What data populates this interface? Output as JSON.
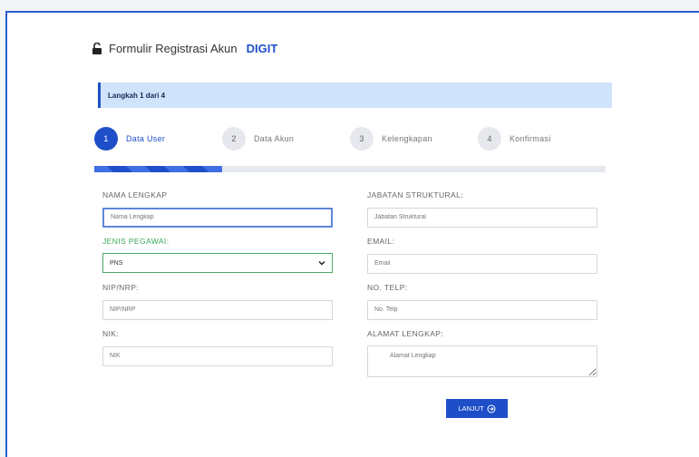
{
  "header": {
    "title_prefix": "Formulir Registrasi Akun",
    "brand": "DIGIT",
    "lock_icon": "lock-open-icon"
  },
  "banner": {
    "text": "Langkah 1 dari 4"
  },
  "steps": [
    {
      "number": "1",
      "label": "Data User",
      "active": true
    },
    {
      "number": "2",
      "label": "Data Akun",
      "active": false
    },
    {
      "number": "3",
      "label": "Kelengkapan",
      "active": false
    },
    {
      "number": "4",
      "label": "Konfirmasi",
      "active": false
    }
  ],
  "progress": {
    "percent": 25
  },
  "form": {
    "nama_lengkap": {
      "label": "NAMA LENGKAP",
      "placeholder": "Nama Lengkap",
      "value": ""
    },
    "jenis_pegawai": {
      "label": "JENIS PEGAWAI:",
      "value": "PNS"
    },
    "nip": {
      "label": "NIP/NRP:",
      "placeholder": "NIP/NRP",
      "value": ""
    },
    "nik": {
      "label": "NIK:",
      "placeholder": "NIK",
      "value": ""
    },
    "jabatan": {
      "label": "JABATAN STRUKTURAL:",
      "placeholder": "Jabatan Struktural",
      "value": ""
    },
    "email": {
      "label": "EMAIL:",
      "placeholder": "Email",
      "value": ""
    },
    "telp": {
      "label": "NO. TELP:",
      "placeholder": "No. Telp",
      "value": ""
    },
    "alamat": {
      "label": "ALAMAT LENGKAP:",
      "placeholder": "Alamat Lengkap",
      "value": ""
    }
  },
  "actions": {
    "next_label": "LANJUT",
    "next_icon": "arrow-right-circle-icon"
  },
  "colors": {
    "primary": "#1e4fc9",
    "banner_bg": "#cfe3fb",
    "success": "#3aa85a"
  }
}
